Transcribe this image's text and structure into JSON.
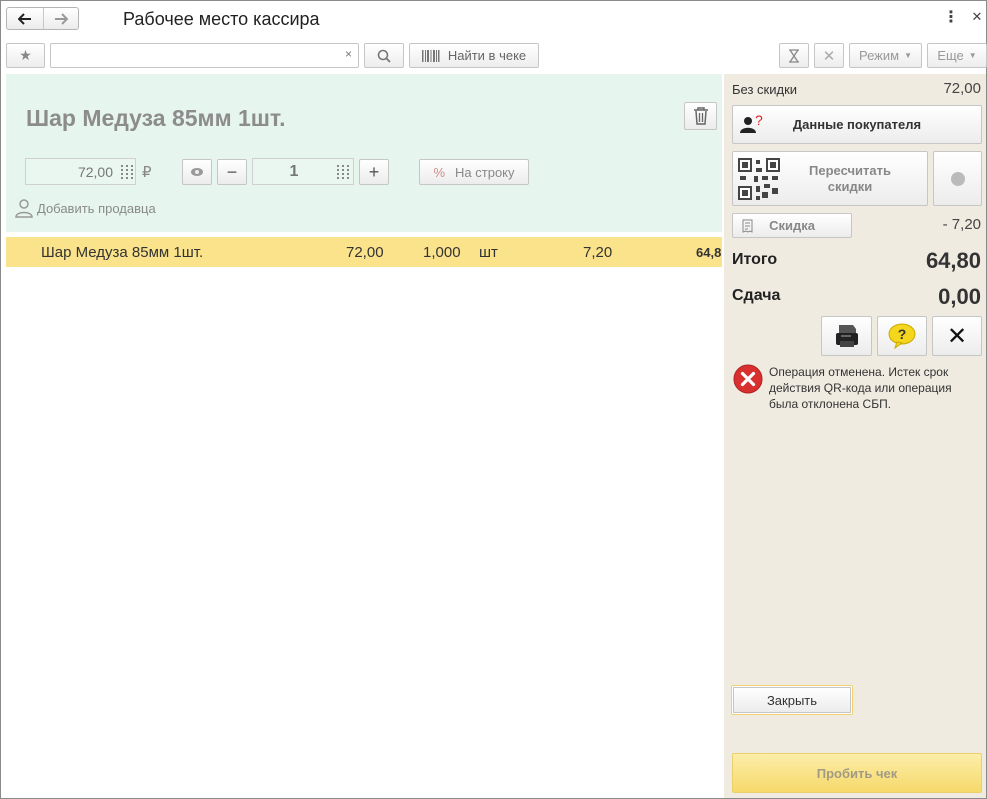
{
  "window": {
    "title": "Рабочее место кассира"
  },
  "toolbar": {
    "search_placeholder": "",
    "search_clear": "×",
    "find_in_receipt": "Найти в чеке",
    "mode_label": "Режим",
    "more_label": "Еще"
  },
  "item": {
    "name": "Шар Медуза 85мм 1шт.",
    "price": "72,00",
    "currency": "₽",
    "quantity": "1",
    "apply_to_row": "На строку",
    "add_seller": "Добавить продавца"
  },
  "rows": [
    {
      "name": "Шар Медуза 85мм 1шт.",
      "price": "72,00",
      "qty": "1,000",
      "unit": "шт",
      "discount": "7,20",
      "sum": "64,8"
    }
  ],
  "summary": {
    "without_discount_label": "Без скидки",
    "without_discount_value": "72,00",
    "customer_data": "Данные покупателя",
    "recalc_discounts": "Пересчитать скидки",
    "discount_label": "Скидка",
    "discount_value": "- 7,20",
    "total_label": "Итого",
    "total_value": "64,80",
    "change_label": "Сдача",
    "change_value": "0,00",
    "error_message": "Операция отменена. Истек срок действия QR-кода или операция была отклонена СБП.",
    "close_label": "Закрыть",
    "punch_label": "Пробить чек"
  },
  "colors": {
    "item_panel_bg": "#e6f5ee",
    "row_highlight": "#fbe38c",
    "right_panel_bg": "#efebe0",
    "punch_button": "#f6d96a",
    "error_red": "#d8302f"
  }
}
